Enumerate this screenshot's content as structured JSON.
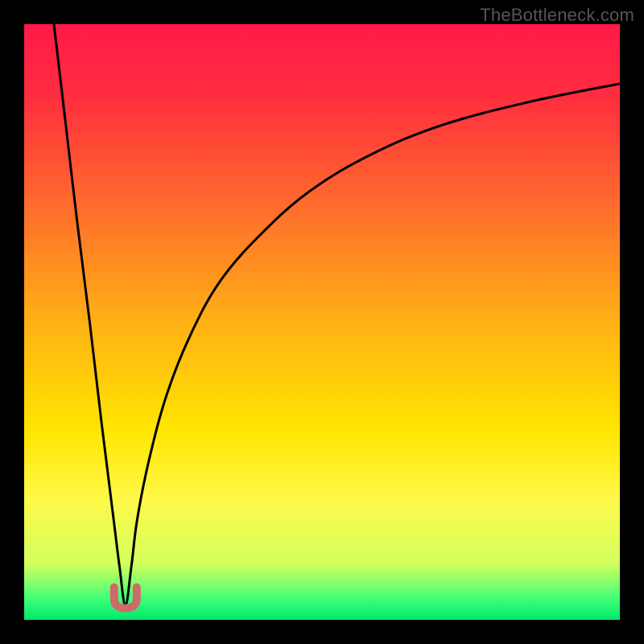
{
  "watermark": {
    "text": "TheBottleneck.com"
  },
  "colors": {
    "frame": "#000000",
    "curve": "#000000",
    "marker_fill": "#cf6a6a",
    "marker_stroke": "#b94e4e",
    "gradient_stops": [
      {
        "offset": 0.0,
        "color": "#ff1a49"
      },
      {
        "offset": 0.12,
        "color": "#ff2d3f"
      },
      {
        "offset": 0.3,
        "color": "#ff6a2d"
      },
      {
        "offset": 0.5,
        "color": "#ffb015"
      },
      {
        "offset": 0.68,
        "color": "#ffe500"
      },
      {
        "offset": 0.8,
        "color": "#fff94a"
      },
      {
        "offset": 0.905,
        "color": "#d3ff5e"
      },
      {
        "offset": 0.935,
        "color": "#8dff6a"
      },
      {
        "offset": 0.965,
        "color": "#3dff78"
      },
      {
        "offset": 1.0,
        "color": "#00e86b"
      }
    ]
  },
  "chart_data": {
    "type": "line",
    "title": "",
    "xlabel": "",
    "ylabel": "",
    "xlim": [
      0,
      100
    ],
    "ylim": [
      0,
      100
    ],
    "grid": false,
    "legend": false,
    "minimum_x": 17,
    "minimum_y": 2.5,
    "marker_u_shape": true,
    "series": [
      {
        "name": "bottleneck-curve",
        "x": [
          5,
          7,
          9,
          11,
          13,
          15,
          16,
          17,
          18,
          19,
          21,
          24,
          28,
          33,
          40,
          48,
          58,
          70,
          85,
          100
        ],
        "y": [
          100,
          83,
          66,
          50,
          33,
          17,
          9,
          2.5,
          9,
          17,
          27,
          38,
          48,
          57,
          65,
          72,
          78,
          83,
          87,
          90
        ]
      }
    ]
  }
}
